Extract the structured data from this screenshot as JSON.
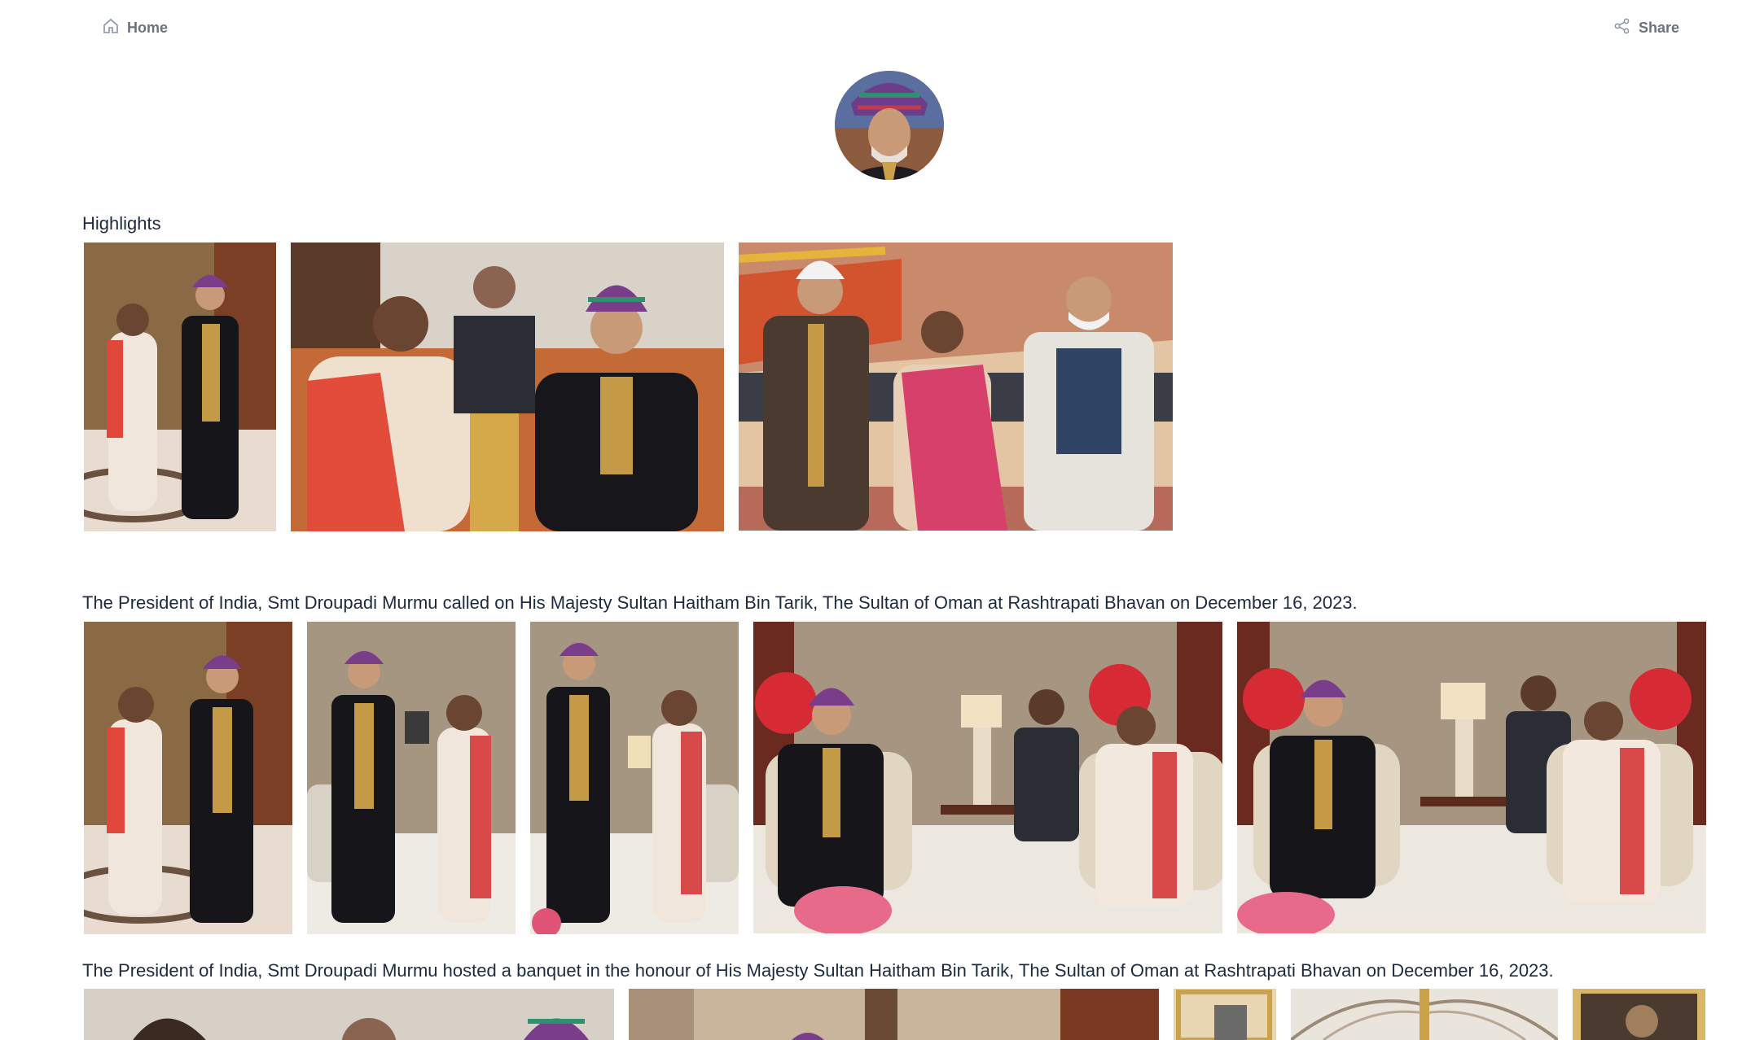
{
  "nav": {
    "home_label": "Home",
    "share_label": "Share",
    "home_icon": "home-icon",
    "share_icon": "share-icon"
  },
  "profile": {
    "avatar_icon": "avatar"
  },
  "sections": [
    {
      "title": "Highlights"
    },
    {
      "title": "The President of India, Smt Droupadi Murmu called on His Majesty Sultan Haitham Bin Tarik, The Sultan of Oman at Rashtrapati Bhavan on December 16, 2023."
    },
    {
      "title": "The President of India, Smt Droupadi Murmu hosted a banquet in the honour of His Majesty Sultan Haitham Bin Tarik, The Sultan of Oman at Rashtrapati Bhavan on December 16, 2023."
    }
  ],
  "colors": {
    "text": "#1e2b3f",
    "muted": "#6b7280",
    "background": "#ffffff"
  }
}
